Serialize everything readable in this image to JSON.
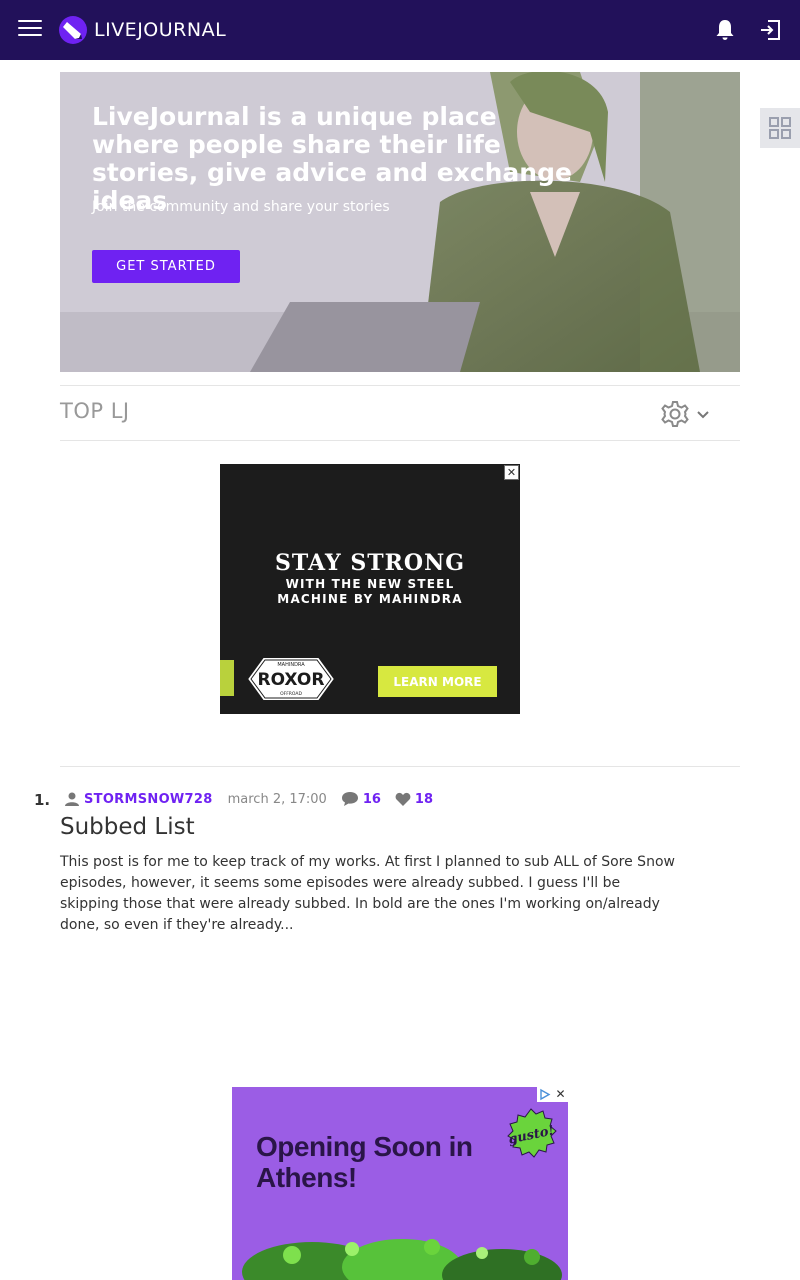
{
  "header": {
    "logo_text": "LIVEJOURNAL",
    "brand_color": "#22115a"
  },
  "hero": {
    "title": "LiveJournal is a unique place where people share their life stories, give advice and exchange ideas",
    "subtitle": "Join the community and share your stories",
    "cta": "GET STARTED",
    "cta_color": "#6f22f2"
  },
  "top_lj": {
    "title": "TOP LJ"
  },
  "ad1": {
    "close": "✕",
    "headline": "STAY STRONG",
    "subline1": "WITH THE NEW STEEL",
    "subline2": "MACHINE BY MAHINDRA",
    "logo_top": "MAHINDRA",
    "logo_main": "ROXOR",
    "logo_bottom": "OFFROAD",
    "cta": "LEARN MORE",
    "cta_color": "#d7e840"
  },
  "posts": [
    {
      "rank": "1.",
      "author": "STORMSNOW728",
      "date": "march 2, 17:00",
      "comments": "16",
      "likes": "18",
      "title": "Subbed List",
      "excerpt": "This post is for me to keep track of my works. At first I planned to sub ALL of Sore Snow episodes, however, it seems some episodes were already subbed. I guess I'll be skipping those that were already subbed. In bold are the ones I'm working on/already done, so even if they're already..."
    }
  ],
  "ad2": {
    "headline": "Opening Soon in Athens!",
    "badge": "gusto!",
    "close": "✕",
    "bg_color": "#9b5de5"
  }
}
